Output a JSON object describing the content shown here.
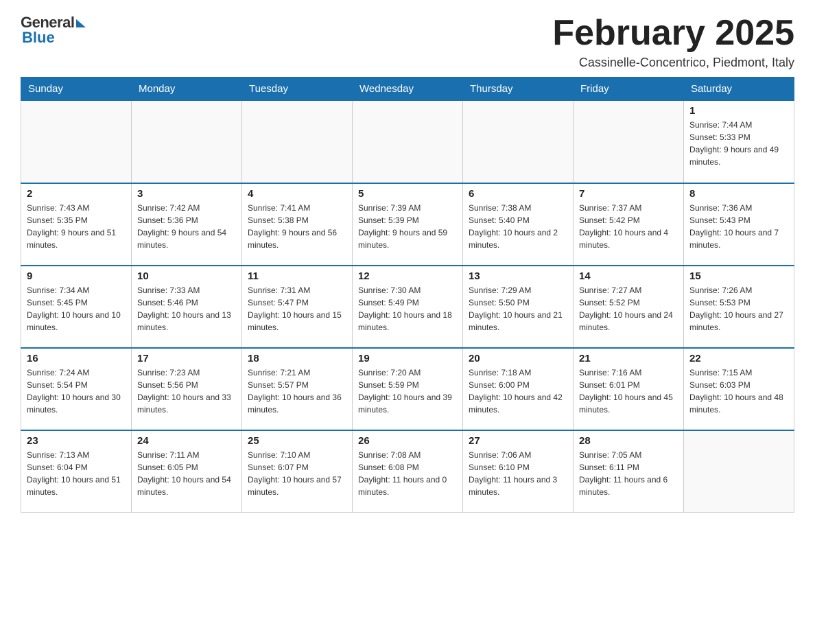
{
  "logo": {
    "general": "General",
    "blue": "Blue"
  },
  "title": "February 2025",
  "location": "Cassinelle-Concentrico, Piedmont, Italy",
  "days_of_week": [
    "Sunday",
    "Monday",
    "Tuesday",
    "Wednesday",
    "Thursday",
    "Friday",
    "Saturday"
  ],
  "weeks": [
    [
      {
        "day": "",
        "info": ""
      },
      {
        "day": "",
        "info": ""
      },
      {
        "day": "",
        "info": ""
      },
      {
        "day": "",
        "info": ""
      },
      {
        "day": "",
        "info": ""
      },
      {
        "day": "",
        "info": ""
      },
      {
        "day": "1",
        "info": "Sunrise: 7:44 AM\nSunset: 5:33 PM\nDaylight: 9 hours and 49 minutes."
      }
    ],
    [
      {
        "day": "2",
        "info": "Sunrise: 7:43 AM\nSunset: 5:35 PM\nDaylight: 9 hours and 51 minutes."
      },
      {
        "day": "3",
        "info": "Sunrise: 7:42 AM\nSunset: 5:36 PM\nDaylight: 9 hours and 54 minutes."
      },
      {
        "day": "4",
        "info": "Sunrise: 7:41 AM\nSunset: 5:38 PM\nDaylight: 9 hours and 56 minutes."
      },
      {
        "day": "5",
        "info": "Sunrise: 7:39 AM\nSunset: 5:39 PM\nDaylight: 9 hours and 59 minutes."
      },
      {
        "day": "6",
        "info": "Sunrise: 7:38 AM\nSunset: 5:40 PM\nDaylight: 10 hours and 2 minutes."
      },
      {
        "day": "7",
        "info": "Sunrise: 7:37 AM\nSunset: 5:42 PM\nDaylight: 10 hours and 4 minutes."
      },
      {
        "day": "8",
        "info": "Sunrise: 7:36 AM\nSunset: 5:43 PM\nDaylight: 10 hours and 7 minutes."
      }
    ],
    [
      {
        "day": "9",
        "info": "Sunrise: 7:34 AM\nSunset: 5:45 PM\nDaylight: 10 hours and 10 minutes."
      },
      {
        "day": "10",
        "info": "Sunrise: 7:33 AM\nSunset: 5:46 PM\nDaylight: 10 hours and 13 minutes."
      },
      {
        "day": "11",
        "info": "Sunrise: 7:31 AM\nSunset: 5:47 PM\nDaylight: 10 hours and 15 minutes."
      },
      {
        "day": "12",
        "info": "Sunrise: 7:30 AM\nSunset: 5:49 PM\nDaylight: 10 hours and 18 minutes."
      },
      {
        "day": "13",
        "info": "Sunrise: 7:29 AM\nSunset: 5:50 PM\nDaylight: 10 hours and 21 minutes."
      },
      {
        "day": "14",
        "info": "Sunrise: 7:27 AM\nSunset: 5:52 PM\nDaylight: 10 hours and 24 minutes."
      },
      {
        "day": "15",
        "info": "Sunrise: 7:26 AM\nSunset: 5:53 PM\nDaylight: 10 hours and 27 minutes."
      }
    ],
    [
      {
        "day": "16",
        "info": "Sunrise: 7:24 AM\nSunset: 5:54 PM\nDaylight: 10 hours and 30 minutes."
      },
      {
        "day": "17",
        "info": "Sunrise: 7:23 AM\nSunset: 5:56 PM\nDaylight: 10 hours and 33 minutes."
      },
      {
        "day": "18",
        "info": "Sunrise: 7:21 AM\nSunset: 5:57 PM\nDaylight: 10 hours and 36 minutes."
      },
      {
        "day": "19",
        "info": "Sunrise: 7:20 AM\nSunset: 5:59 PM\nDaylight: 10 hours and 39 minutes."
      },
      {
        "day": "20",
        "info": "Sunrise: 7:18 AM\nSunset: 6:00 PM\nDaylight: 10 hours and 42 minutes."
      },
      {
        "day": "21",
        "info": "Sunrise: 7:16 AM\nSunset: 6:01 PM\nDaylight: 10 hours and 45 minutes."
      },
      {
        "day": "22",
        "info": "Sunrise: 7:15 AM\nSunset: 6:03 PM\nDaylight: 10 hours and 48 minutes."
      }
    ],
    [
      {
        "day": "23",
        "info": "Sunrise: 7:13 AM\nSunset: 6:04 PM\nDaylight: 10 hours and 51 minutes."
      },
      {
        "day": "24",
        "info": "Sunrise: 7:11 AM\nSunset: 6:05 PM\nDaylight: 10 hours and 54 minutes."
      },
      {
        "day": "25",
        "info": "Sunrise: 7:10 AM\nSunset: 6:07 PM\nDaylight: 10 hours and 57 minutes."
      },
      {
        "day": "26",
        "info": "Sunrise: 7:08 AM\nSunset: 6:08 PM\nDaylight: 11 hours and 0 minutes."
      },
      {
        "day": "27",
        "info": "Sunrise: 7:06 AM\nSunset: 6:10 PM\nDaylight: 11 hours and 3 minutes."
      },
      {
        "day": "28",
        "info": "Sunrise: 7:05 AM\nSunset: 6:11 PM\nDaylight: 11 hours and 6 minutes."
      },
      {
        "day": "",
        "info": ""
      }
    ]
  ]
}
